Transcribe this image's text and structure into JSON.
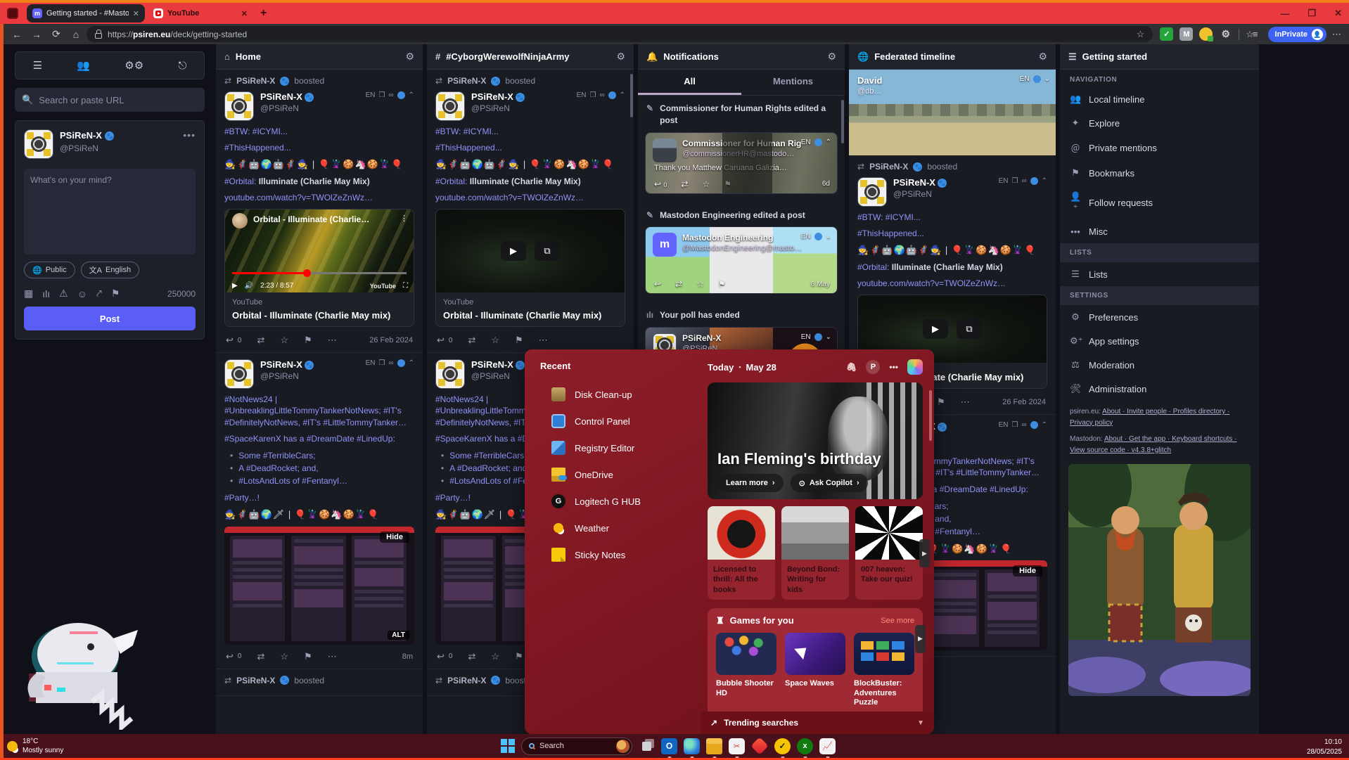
{
  "browser": {
    "tab1": "Getting started - #MastodonSpyB",
    "tab2": "YouTube",
    "url_prefix": "https://",
    "url_domain": "psiren.eu",
    "url_path": "/deck/getting-started",
    "inprivate": "InPrivate"
  },
  "sidebar": {
    "search_placeholder": "Search or paste URL",
    "name": "PSiReN-X",
    "handle": "@PSiReN",
    "compose_placeholder": "What's on your mind?",
    "visibility": "Public",
    "language": "English",
    "char_count": "250000",
    "post_label": "Post"
  },
  "columns": {
    "home": "Home",
    "cyborg": "#CyborgWerewolfNinjaArmy",
    "notifications": "Notifications",
    "federated": "Federated timeline",
    "getting_started": "Getting started"
  },
  "post_orbital": {
    "boost_name": "PSiReN-X",
    "boosted": "boosted",
    "name": "PSiReN-X",
    "handle": "@PSiReN",
    "lang": "EN",
    "line1": "#BTW: #ICYMI...",
    "line2": "#ThisHappened...",
    "emoji": "🧙🦸🤖🌍🤖🦸🧙 | 🎈🦹🍪🦄🍪🦹🎈",
    "tag": "#Orbital:",
    "tag_rest": " Illuminate (Charlie May Mix)",
    "link": "youtube.com/watch?v=TWOlZeZnWz…",
    "video_title": "Orbital - Illuminate (Charlie…",
    "video_time": "2:23 / 8:57",
    "video_brand": "YouTube",
    "provider": "YouTube",
    "card_title": "Orbital - Illuminate (Charlie May mix)",
    "replies": "0",
    "date": "26 Feb 2024"
  },
  "post_notnews": {
    "name": "PSiReN-X",
    "handle": "@PSiReN",
    "lang": "EN",
    "body1": "#NotNews24 |",
    "body2": "#UnbreaklingLittleTommyTankerNotNews; #IT's",
    "body3": "#DefinitelyNotNews, #IT's #LittleTommyTanker…",
    "dream": "#SpaceKarenX has a #DreamDate #LinedUp:",
    "b1": "Some #TerribleCars;",
    "b2": "A #DeadRocket; and,",
    "b3": "#LotsAndLots of #Fentanyl…",
    "party": "#Party…!",
    "emoji": "🧙🦸🤖🌍🗡 | 🎈🦹🍪🦄🍪🦹🎈",
    "hide": "Hide",
    "alt": "ALT",
    "time": "8m",
    "replies": "0",
    "boost_footer_name": "PSiReN-X",
    "boost_footer": "boosted"
  },
  "notifications": {
    "tab_all": "All",
    "tab_mentions": "Mentions",
    "n1_text": "Commissioner for Human Rights edited a post",
    "n1_name": "Commissioner for Human Rig",
    "n1_handle": "@commissionerHR@mastodo…",
    "n1_body": "Thank you Matthew Caruana Galizia…",
    "n1_replies": "0",
    "n1_time": "6d",
    "n2_text": "Mastodon Engineering edited a post",
    "n2_name": "Mastodon Engineering",
    "n2_handle": "@MastodonEngineering@masto…",
    "n2_time": "6 May",
    "n3_text": "Your poll has ended",
    "n3_name": "PSiReN-X",
    "n3_handle": "@PSiReN",
    "n3_lang": "EN"
  },
  "federated": {
    "p1_name": "David",
    "p1_handle": "@db…",
    "p1_lang": "EN",
    "hide": "Hide"
  },
  "nav": {
    "s1": "NAVIGATION",
    "i1": "Local timeline",
    "i2": "Explore",
    "i3": "Private mentions",
    "i4": "Bookmarks",
    "i5": "Follow requests",
    "i6": "Misc",
    "s2": "LISTS",
    "i7": "Lists",
    "s3": "SETTINGS",
    "i8": "Preferences",
    "i9": "App settings",
    "i10": "Moderation",
    "i11": "Administration",
    "footer1_prefix": "psiren.eu:",
    "footer1": "About · Invite people · Profiles directory · Privacy policy",
    "footer2_prefix": "Mastodon:",
    "footer2": "About · Get the app · Keyboard shortcuts · View source code · v4.3.8+glitch",
    "hide": "Hide"
  },
  "widgets": {
    "recent_title": "Recent",
    "r1": "Disk Clean-up",
    "r2": "Control Panel",
    "r3": "Registry Editor",
    "r4": "OneDrive",
    "r5": "Logitech G HUB",
    "r6": "Weather",
    "r7": "Sticky Notes",
    "today": "Today",
    "date": "May 28",
    "profile_initial": "P",
    "fleming_title": "Ian Fleming's birthday",
    "learn_more": "Learn more",
    "ask_copilot": "Ask Copilot",
    "tile1": "Licensed to thrill: All the books",
    "tile2": "Beyond Bond: Writing for kids",
    "tile3": "007 heaven: Take our quiz!",
    "games_title": "Games for you",
    "see_more": "See more",
    "g1": "Bubble Shooter HD",
    "g2": "Space Waves",
    "g3": "BlockBuster: Adventures Puzzle",
    "trending": "Trending searches"
  },
  "taskbar": {
    "temp": "18°C",
    "condition": "Mostly sunny",
    "search": "Search",
    "time": "10:10",
    "date": "28/05/2025"
  }
}
